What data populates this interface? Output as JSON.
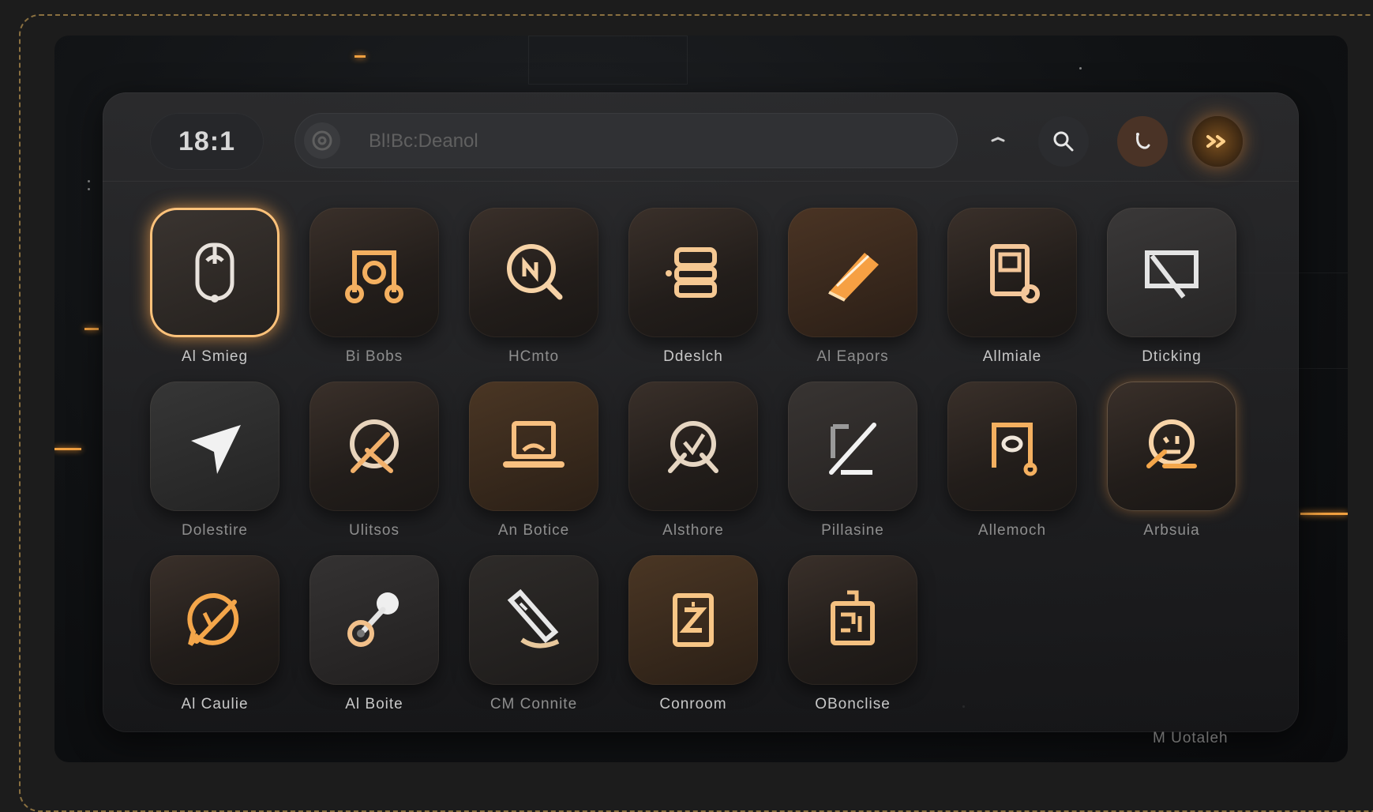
{
  "header": {
    "clock": "18:1",
    "search_placeholder": "Bl!Bc:Deanol",
    "buttons": [
      {
        "name": "minimize",
        "icon": "minus-icon"
      },
      {
        "name": "search",
        "icon": "search-icon"
      },
      {
        "name": "call",
        "icon": "phone-icon"
      },
      {
        "name": "forward",
        "icon": "double-chevron-icon"
      }
    ]
  },
  "apps": [
    {
      "label": "Al Smieg",
      "icon": "mouse-icon",
      "active": true
    },
    {
      "label": "Bi Bobs",
      "icon": "music-note-icon"
    },
    {
      "label": "HCmto",
      "icon": "magnifier-icon"
    },
    {
      "label": "Ddeslch",
      "icon": "stack-icon"
    },
    {
      "label": "Al Eapors",
      "icon": "pen-icon"
    },
    {
      "label": "Allmiale",
      "icon": "document-gear-icon"
    },
    {
      "label": "Dticking",
      "icon": "screen-slash-icon"
    },
    {
      "label": "Dolestire",
      "icon": "navigation-arrow-icon"
    },
    {
      "label": "Ulitsos",
      "icon": "no-tools-icon"
    },
    {
      "label": "An Botice",
      "icon": "laptop-icon"
    },
    {
      "label": "Alsthore",
      "icon": "badge-check-icon"
    },
    {
      "label": "Pillasine",
      "icon": "crop-slash-icon"
    },
    {
      "label": "Allemoch",
      "icon": "music-note-icon"
    },
    {
      "label": "Arbsuia",
      "icon": "face-slash-icon"
    },
    {
      "label": "Al Caulie",
      "icon": "chat-slash-icon"
    },
    {
      "label": "Al Boite",
      "icon": "joystick-icon"
    },
    {
      "label": "CM Connite",
      "icon": "pencil-tool-icon"
    },
    {
      "label": "Conroom",
      "icon": "z-document-icon"
    },
    {
      "label": "OBonclise",
      "icon": "circuit-icon"
    }
  ],
  "footer_label": "M Uotaleh",
  "colors": {
    "accent": "#f4a64a",
    "glow": "#ffc27a",
    "panel": "#242426"
  }
}
